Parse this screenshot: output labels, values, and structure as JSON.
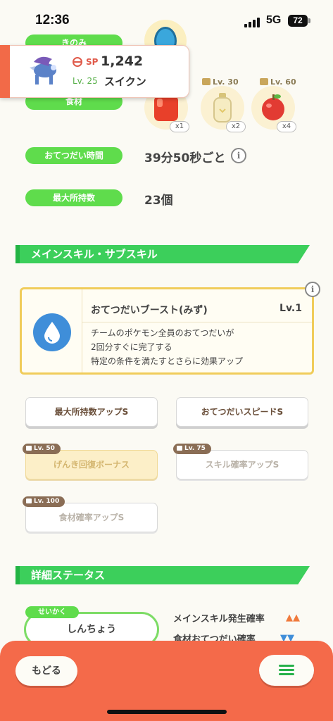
{
  "status_bar": {
    "time": "12:36",
    "network": "5G",
    "battery": "72"
  },
  "pokemon": {
    "sp_label": "SP",
    "sp_value": "1,242",
    "level": "Lv. 25",
    "name": "スイクン"
  },
  "labels": {
    "berry": "きのみ",
    "ingredient": "食材",
    "help_time": "おてつだい時間",
    "max_carry": "最大所持数"
  },
  "values": {
    "help_time": "39分50秒ごと",
    "max_carry": "23個"
  },
  "ingredients": [
    {
      "unlock": "",
      "qty": "x1",
      "color": "#e8402a"
    },
    {
      "unlock": "Lv. 30",
      "qty": "x2",
      "color": "#f4e8b8"
    },
    {
      "unlock": "Lv. 60",
      "qty": "x4",
      "color": "#e23b33"
    }
  ],
  "sections": {
    "skills": "メインスキル・サブスキル",
    "details": "詳細ステータス"
  },
  "main_skill": {
    "name": "おてつだいブースト(みず)",
    "level": "Lv.1",
    "desc": [
      "チームのポケモン全員のおてつだいが",
      "2回分すぐに完了する",
      "特定の条件を満たすとさらに効果アップ"
    ]
  },
  "sub_skills": [
    {
      "label": "最大所持数アップS",
      "unlock": ""
    },
    {
      "label": "おてつだいスピードS",
      "unlock": ""
    },
    {
      "label": "げんき回復ボーナス",
      "unlock": "Lv. 50"
    },
    {
      "label": "スキル確率アップS",
      "unlock": "Lv. 75"
    },
    {
      "label": "食材確率アップS",
      "unlock": "Lv. 100"
    }
  ],
  "nature": {
    "tag": "せいかく",
    "value": "しんちょう"
  },
  "stats": [
    {
      "label": "メインスキル発生確率",
      "arrows": "▲▲",
      "color": "#f07a3c"
    },
    {
      "label": "食材おてつだい確率",
      "arrows": "▼▼",
      "color": "#3f8ed9"
    }
  ],
  "nav": {
    "back": "もどる"
  },
  "info_glyph": "i"
}
